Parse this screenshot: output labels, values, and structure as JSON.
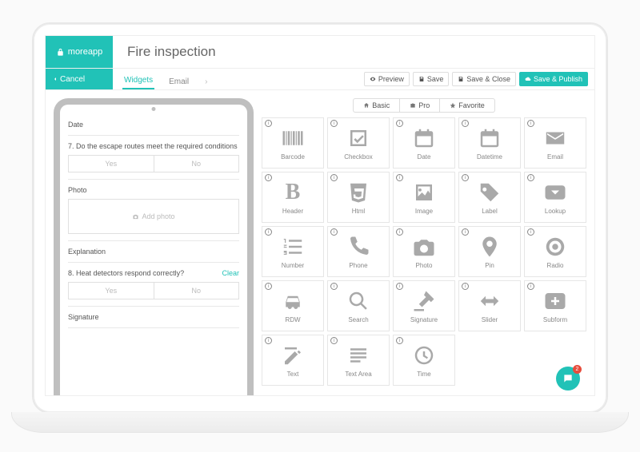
{
  "brand": "moreapp",
  "title": "Fire inspection",
  "cancel": "Cancel",
  "tabs": {
    "widgets": "Widgets",
    "email": "Email"
  },
  "actions": {
    "preview": "Preview",
    "save": "Save",
    "saveClose": "Save & Close",
    "savePublish": "Save & Publish"
  },
  "categories": {
    "basic": "Basic",
    "pro": "Pro",
    "favorite": "Favorite"
  },
  "form": {
    "date_label": "Date",
    "q7": "7. Do the escape routes meet the required conditions",
    "yes": "Yes",
    "no": "No",
    "photo_label": "Photo",
    "add_photo": "Add photo",
    "explanation_label": "Explanation",
    "q8": "8. Heat detectors respond correctly?",
    "clear": "Clear",
    "signature_label": "Signature"
  },
  "widgets": {
    "barcode": "Barcode",
    "checkbox": "Checkbox",
    "date": "Date",
    "datetime": "Datetime",
    "email": "Email",
    "header": "Header",
    "html": "Html",
    "image": "Image",
    "label": "Label",
    "lookup": "Lookup",
    "number": "Number",
    "phone": "Phone",
    "photo": "Photo",
    "pin": "Pin",
    "radio": "Radio",
    "rdw": "RDW",
    "search": "Search",
    "signature": "Signature",
    "slider": "Slider",
    "subform": "Subform",
    "text": "Text",
    "textarea": "Text Area",
    "time": "Time"
  },
  "chat_badge": "2"
}
